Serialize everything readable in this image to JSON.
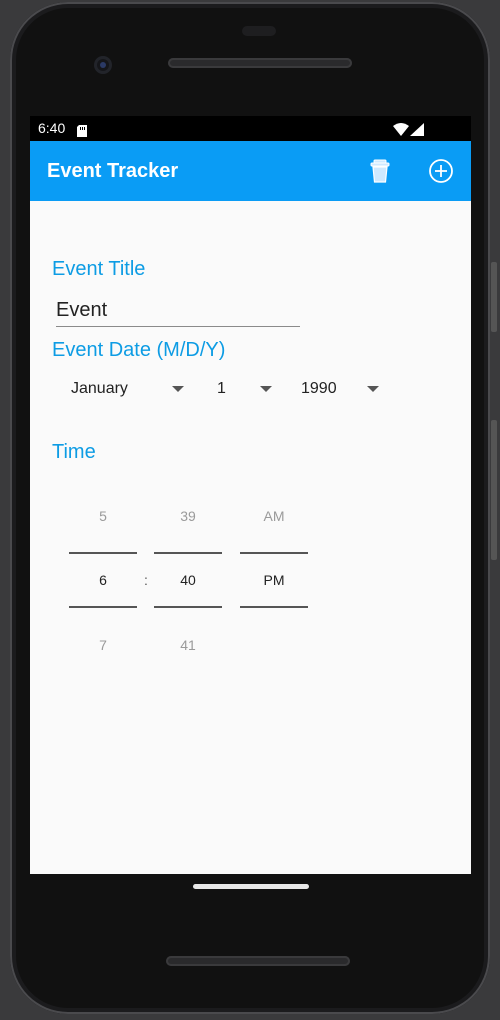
{
  "status_bar": {
    "time": "6:40"
  },
  "app_bar": {
    "title": "Event Tracker",
    "actions": [
      {
        "icon": "trash-icon"
      },
      {
        "icon": "add-circle-icon"
      }
    ],
    "color": "#0a9cf5"
  },
  "form": {
    "event_title_label": "Event Title",
    "event_title_value": "Event",
    "event_date_label": "Event Date (M/D/Y)",
    "month": "January",
    "day": "1",
    "year": "1990",
    "time_label": "Time"
  },
  "time_picker": {
    "hour": {
      "prev": "5",
      "current": "6",
      "next": "7"
    },
    "minute": {
      "prev": "39",
      "current": "40",
      "next": "41"
    },
    "separator": ":",
    "ampm": {
      "prev": "AM",
      "current": "PM"
    }
  },
  "colors": {
    "accent": "#0d9ce4",
    "background": "#fafafa"
  }
}
